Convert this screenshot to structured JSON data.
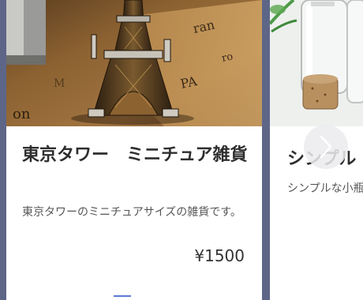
{
  "carousel": {
    "items": [
      {
        "title": "東京タワー　ミニチュア雑貨",
        "description": "東京タワーのミニチュアサイズの雑貨です。",
        "price": "¥1500"
      },
      {
        "title": "シンプル",
        "description": "シンプルな小瓶"
      }
    ],
    "next_icon": "chevron-right-icon"
  },
  "colors": {
    "page_background": "#5d6687",
    "card_background": "#ffffff",
    "accent": "#5b7bd6"
  }
}
